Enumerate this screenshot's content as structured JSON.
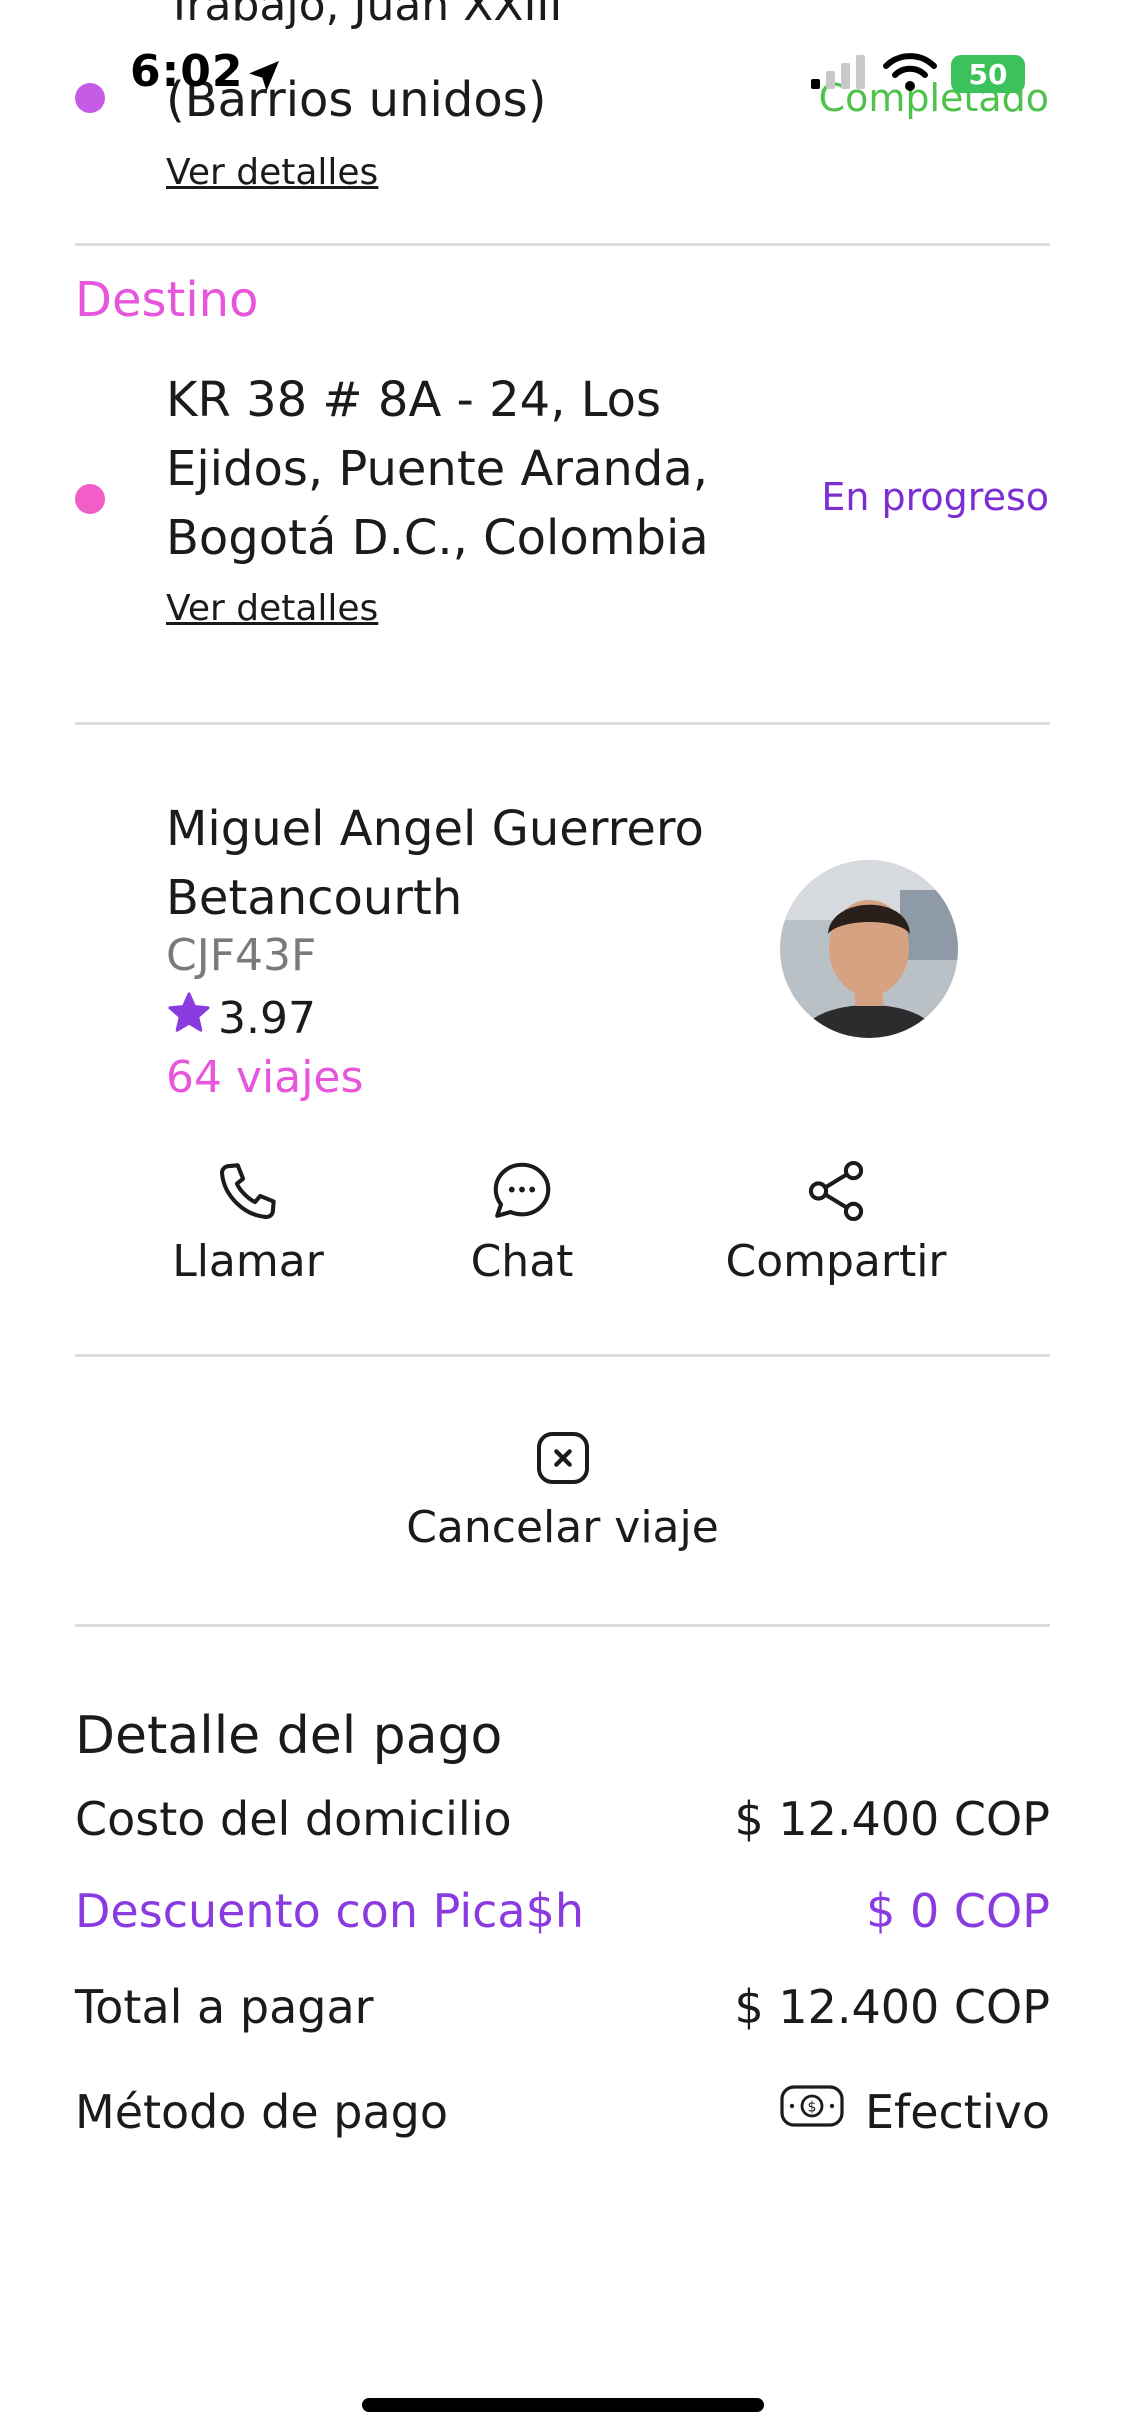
{
  "status_bar": {
    "time": "6:02",
    "battery": "50"
  },
  "origin": {
    "cut_text": "Trabajo, Juan XXIII",
    "address_line": "(Barrios unidos)",
    "link": "Ver detalles",
    "status": "Completado"
  },
  "destination": {
    "label": "Destino",
    "address": "KR 38 # 8A - 24, Los Ejidos, Puente Aranda, Bogotá D.C., Colombia",
    "link": "Ver detalles",
    "status": "En progreso"
  },
  "driver": {
    "name": "Miguel Angel Guerrero Betancourth",
    "plate": "CJF43F",
    "rating": "3.97",
    "trips": "64 viajes"
  },
  "actions": {
    "call": "Llamar",
    "chat": "Chat",
    "share": "Compartir"
  },
  "cancel": {
    "label": "Cancelar viaje"
  },
  "payment": {
    "title": "Detalle del pago",
    "rows": [
      {
        "label": "Costo del domicilio",
        "value": "$ 12.400 COP"
      },
      {
        "label": "Descuento con Pica$h",
        "value": "$ 0 COP"
      },
      {
        "label": "Total a pagar",
        "value": "$ 12.400 COP"
      },
      {
        "label": "Método de pago",
        "value": "Efectivo"
      }
    ]
  },
  "colors": {
    "accent_pink": "#e855dd",
    "accent_purple": "#7b2fd1",
    "success_green": "#4fc24c"
  }
}
